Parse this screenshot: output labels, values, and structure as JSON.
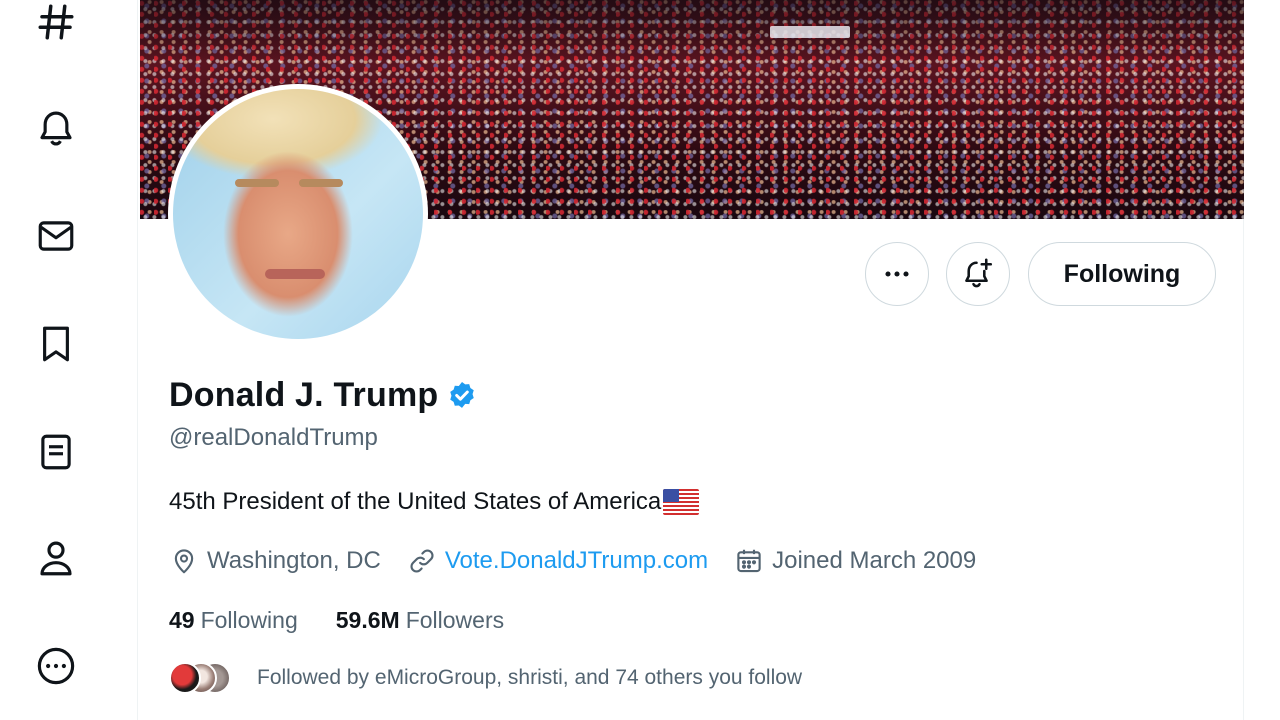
{
  "nav": {
    "items": [
      {
        "name": "explore",
        "icon": "hash-icon"
      },
      {
        "name": "notifications",
        "icon": "bell-icon"
      },
      {
        "name": "messages",
        "icon": "mail-icon"
      },
      {
        "name": "bookmarks",
        "icon": "bookmark-icon"
      },
      {
        "name": "lists",
        "icon": "list-icon"
      },
      {
        "name": "profile",
        "icon": "person-icon"
      },
      {
        "name": "more",
        "icon": "more-circle-icon"
      }
    ]
  },
  "profile": {
    "display_name": "Donald J. Trump",
    "verified": true,
    "handle": "@realDonaldTrump",
    "bio": "45th President of the United States of America",
    "bio_emoji": "us-flag",
    "location": "Washington, DC",
    "website": "Vote.DonaldJTrump.com",
    "joined": "Joined March 2009",
    "following_count": "49",
    "following_label": "Following",
    "followers_count": "59.6M",
    "followers_label": "Followers",
    "followed_by_text": "Followed by eMicroGroup, shristi, and 74 others you follow"
  },
  "actions": {
    "more_icon": "ellipsis-icon",
    "notify_icon": "bell-plus-icon",
    "following_button": "Following"
  },
  "colors": {
    "accent": "#1d9bf0",
    "text_primary": "#0f1419",
    "text_secondary": "#536471",
    "border": "#cfd9de"
  }
}
